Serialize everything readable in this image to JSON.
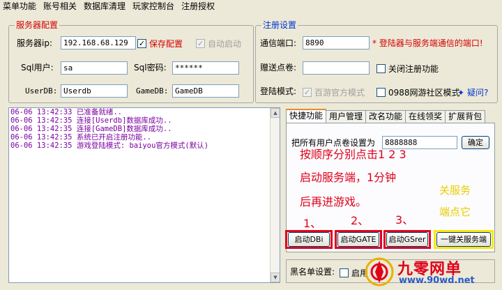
{
  "menu": [
    "菜单功能",
    "账号相关",
    "数据库清理",
    "玩家控制台",
    "注册授权"
  ],
  "server_config": {
    "title": "服务器配置",
    "ip_label": "服务器ip:",
    "ip_value": "192.168.68.129",
    "save_config_label": "保存配置",
    "save_config_checked": "✓",
    "auto_start_label": "自动启动",
    "auto_start_checked": "✓",
    "sql_user_label": "Sql用户:",
    "sql_user_value": "sa",
    "sql_pass_label": "Sql密码:",
    "sql_pass_value": "******",
    "userdb_label": "UserDB:",
    "userdb_value": "Userdb",
    "gamedb_label": "GameDB:",
    "gamedb_value": "GameDB"
  },
  "register": {
    "title": "注册设置",
    "port_label": "通信端口:",
    "port_value": "8890",
    "port_note": "* 登陆器与服务端通信的端口!",
    "gift_label": "赠送点卷:",
    "gift_value": "",
    "close_register_label": "关闭注册功能",
    "login_mode_label": "登陆模式:",
    "baiyou_label": "百游官方模式",
    "baiyou_checked": "✓",
    "community_label": "0988网游社区模式",
    "help_label": "疑问?"
  },
  "log": [
    "06-06 13:42:33 已准备就绪..",
    "06-06 13:42:35 连接[Userdb]数据库成功..",
    "06-06 13:42:35 连接[GameDB]数据库成功..",
    "06-06 13:42:35 系统已开启注册功能..",
    "06-06 13:42:35 游戏登陆模式: baiyou官方模式(默认)"
  ],
  "tabs": [
    "快捷功能",
    "用户管理",
    "改名功能",
    "在线领奖",
    "扩展背包"
  ],
  "quick": {
    "set_points_label": "把所有用户点卷设置为",
    "set_points_value": "8888888",
    "confirm_label": "确定",
    "btn_dbi": "启动DBi",
    "btn_gate": "启动GATE",
    "btn_gsrer": "启动GSrer",
    "btn_shutdown": "一键关服务端"
  },
  "annotations": {
    "line1": "按顺序分别点击1 2 3",
    "line2": "启动服务端，1分钟",
    "line3": "后再进游戏。",
    "n1": "1、",
    "n2": "2、",
    "n3": "3、",
    "close1": "关服务",
    "close2": "端点它"
  },
  "blacklist": {
    "label": "黑名单设置:",
    "enable_label": "启用"
  },
  "watermark": {
    "title": "九零网单",
    "url": "www.90wd.net"
  }
}
